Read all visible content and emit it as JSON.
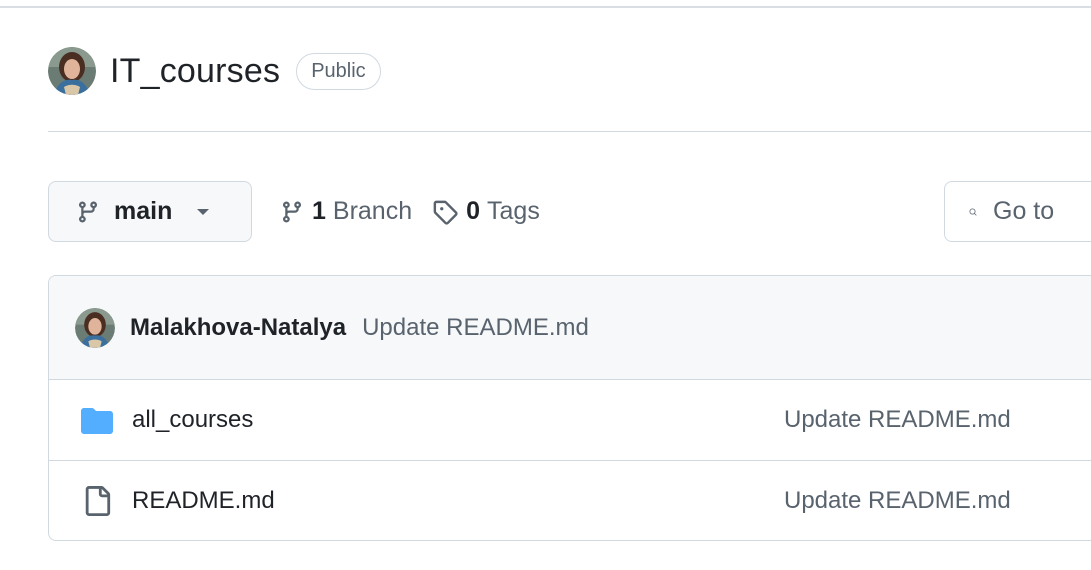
{
  "repo": {
    "name": "IT_courses",
    "visibility": "Public",
    "owner_avatar": "avatar"
  },
  "toolbar": {
    "branch": "main",
    "branch_count": "1",
    "branch_label": "Branch",
    "tag_count": "0",
    "tag_label": "Tags",
    "search_placeholder": "Go to"
  },
  "latest_commit": {
    "author": "Malakhova-Natalya",
    "message": "Update README.md"
  },
  "files": [
    {
      "type": "folder",
      "icon": "folder-icon",
      "name": "all_courses",
      "last_commit": "Update README.md"
    },
    {
      "type": "file",
      "icon": "file-icon",
      "name": "README.md",
      "last_commit": "Update README.md"
    }
  ],
  "colors": {
    "folder": "#54aeff",
    "muted_text": "#59636e",
    "border": "#d1d9e0",
    "subtle_bg": "#f6f8fa"
  }
}
